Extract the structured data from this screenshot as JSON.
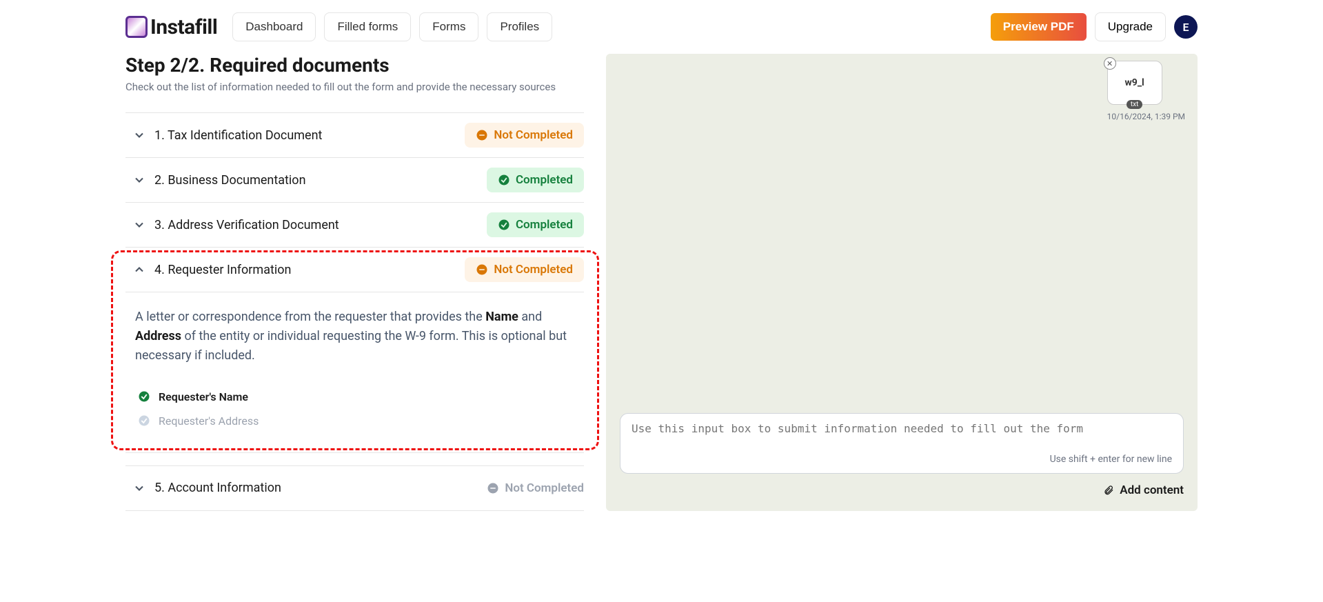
{
  "header": {
    "brand": "Instafill",
    "nav": {
      "dashboard": "Dashboard",
      "filled_forms": "Filled forms",
      "forms": "Forms",
      "profiles": "Profiles"
    },
    "preview": "Preview PDF",
    "upgrade": "Upgrade",
    "avatar_initial": "E"
  },
  "step": {
    "title": "Step 2/2. Required documents",
    "subtitle": "Check out the list of information needed to fill out the form and provide the necessary sources"
  },
  "status_labels": {
    "not_completed": "Not Completed",
    "completed": "Completed"
  },
  "docs": {
    "d1": "1. Tax Identification Document",
    "d2": "2. Business Documentation",
    "d3": "3. Address Verification Document",
    "d4": "4. Requester Information",
    "d5": "5. Account Information"
  },
  "expanded": {
    "pre": "A letter or correspondence from the requester that provides the ",
    "b1": "Name",
    "mid1": " and ",
    "b2": "Address",
    "post": " of the entity or individual requesting the W-9 form. This is optional but necessary if included.",
    "sub1": "Requester's Name",
    "sub2": "Requester's Address"
  },
  "file": {
    "name": "w9_l",
    "ext": "txt",
    "date": "10/16/2024, 1:39 PM"
  },
  "input": {
    "placeholder": "Use this input box to submit information needed to fill out the form",
    "hint": "Use shift + enter for new line",
    "add_content": "Add content"
  }
}
